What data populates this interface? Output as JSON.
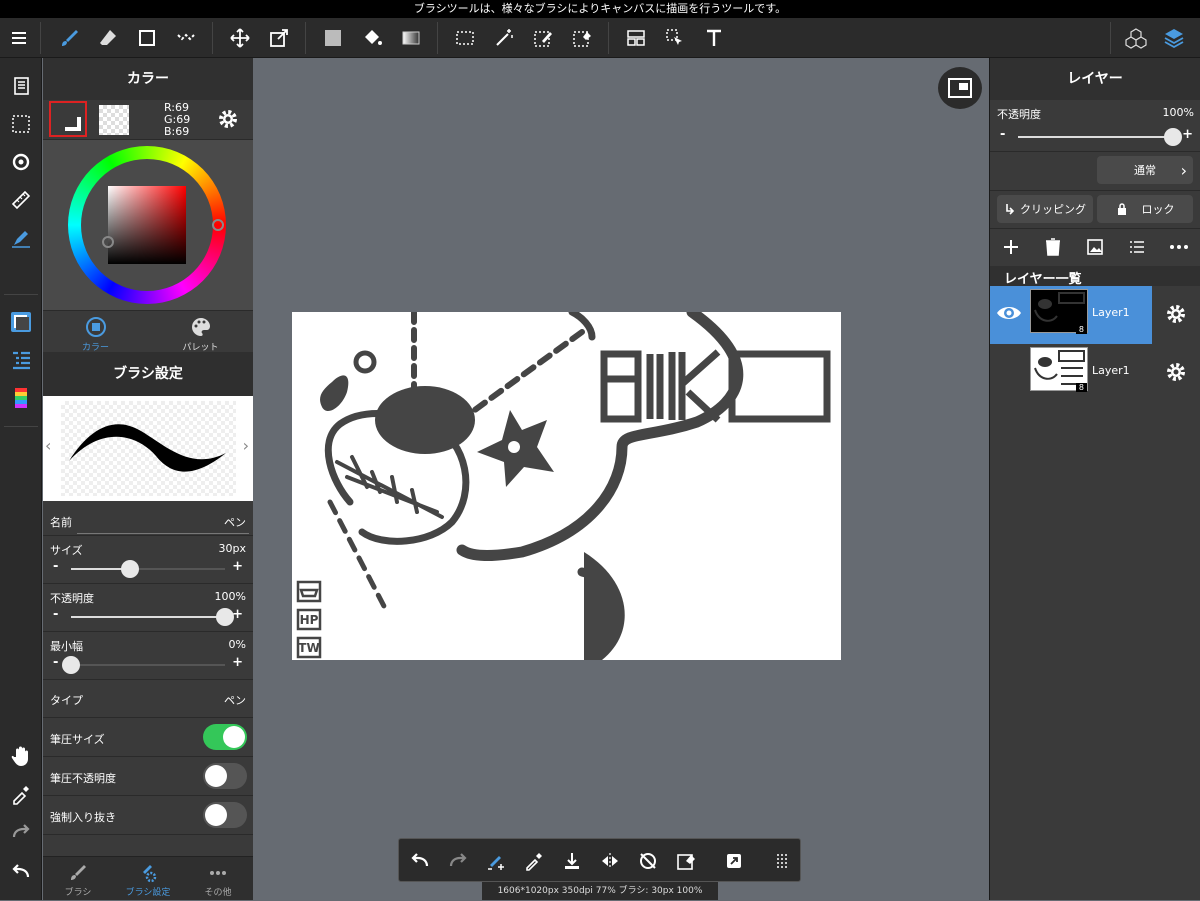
{
  "tip": "ブラシツールは、様々なブラシによりキャンバスに描画を行うツールです。",
  "color_panel": {
    "title": "カラー",
    "rgb": {
      "r": "R:69",
      "g": "G:69",
      "b": "B:69"
    },
    "tabs": [
      "カラー",
      "パレット"
    ]
  },
  "brush_panel": {
    "title": "ブラシ設定",
    "name_label": "名前",
    "name_value": "ペン",
    "size_label": "サイズ",
    "size_value": "30px",
    "opacity_label": "不透明度",
    "opacity_value": "100%",
    "minwidth_label": "最小幅",
    "minwidth_value": "0%",
    "type_label": "タイプ",
    "type_value": "ペン",
    "pressure_size_label": "筆圧サイズ",
    "pressure_opacity_label": "筆圧不透明度",
    "forced_taper_label": "強制入り抜き",
    "pressure_size_on": true,
    "pressure_opacity_on": false,
    "forced_taper_on": false,
    "size_level": 0.38,
    "opacity_level": 1.0,
    "minwidth_level": 0.0
  },
  "bottom_tabs": [
    "ブラシ",
    "ブラシ設定",
    "その他"
  ],
  "layer_panel": {
    "title": "レイヤー",
    "opacity_label": "不透明度",
    "opacity_value": "100%",
    "blend_mode": "通常",
    "clipping_label": "クリッピング",
    "lock_label": "ロック",
    "list_title": "レイヤー一覧",
    "layers": [
      {
        "name": "Layer1",
        "badge": "8"
      },
      {
        "name": "Layer1",
        "badge": "8"
      }
    ]
  },
  "canvas_art": {
    "title_text": "BIIKO",
    "badges": [
      "HP",
      "TW"
    ]
  },
  "status": "1606*1020px 350dpi 77% ブラシ: 30px 100%",
  "colors": {
    "accent": "#4a9be0",
    "toggle_on": "#34c759",
    "selected_layer": "#4a90d9",
    "foreground": "#454545"
  }
}
